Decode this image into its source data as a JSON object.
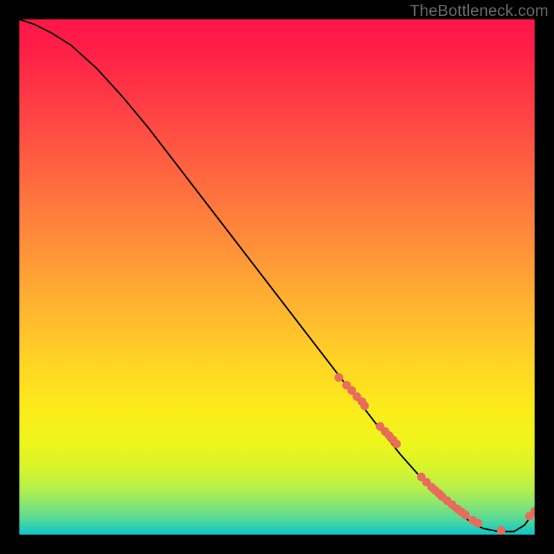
{
  "watermark": "TheBottleneck.com",
  "chart_data": {
    "type": "line",
    "title": "",
    "xlabel": "",
    "ylabel": "",
    "xlim": [
      0,
      100
    ],
    "ylim": [
      0,
      100
    ],
    "grid": false,
    "legend": false,
    "series": [
      {
        "name": "curve",
        "style": "line",
        "color": "#000000",
        "x": [
          0,
          3,
          6,
          10,
          15,
          20,
          25,
          30,
          35,
          40,
          45,
          50,
          55,
          60,
          65,
          70,
          74,
          78,
          82,
          85,
          88,
          90,
          93,
          96,
          98,
          100
        ],
        "y": [
          100,
          99,
          97.5,
          95,
          90.5,
          85,
          79,
          72.5,
          66,
          59.5,
          53,
          46.5,
          40,
          33.5,
          27,
          20.5,
          15.5,
          11,
          7,
          4.3,
          2.2,
          1.2,
          0.6,
          0.6,
          1.8,
          4.5
        ]
      },
      {
        "name": "dots",
        "style": "scatter",
        "color": "#e86b5b",
        "x": [
          62,
          63.5,
          64.5,
          65.5,
          66.5,
          67,
          70,
          71,
          71.8,
          72.5,
          73.2,
          78,
          79,
          80,
          80.7,
          81.4,
          82,
          83,
          84,
          85,
          85.8,
          86.6,
          88,
          89,
          93.5,
          99,
          100
        ],
        "y": [
          30.5,
          29,
          28,
          26.8,
          25.8,
          25,
          21,
          20,
          19.2,
          18.4,
          17.6,
          11.2,
          10.2,
          9.2,
          8.6,
          8,
          7.4,
          6.6,
          5.8,
          5,
          4.4,
          3.8,
          2.8,
          2.2,
          0.8,
          3.6,
          4.5
        ]
      }
    ],
    "background_gradient": {
      "direction": "vertical",
      "stops": [
        {
          "pos": 0.0,
          "color": "#ff1648"
        },
        {
          "pos": 0.5,
          "color": "#ffbb2e"
        },
        {
          "pos": 0.8,
          "color": "#fbec1a"
        },
        {
          "pos": 0.95,
          "color": "#56d998"
        },
        {
          "pos": 1.0,
          "color": "#10c8c8"
        }
      ]
    }
  }
}
